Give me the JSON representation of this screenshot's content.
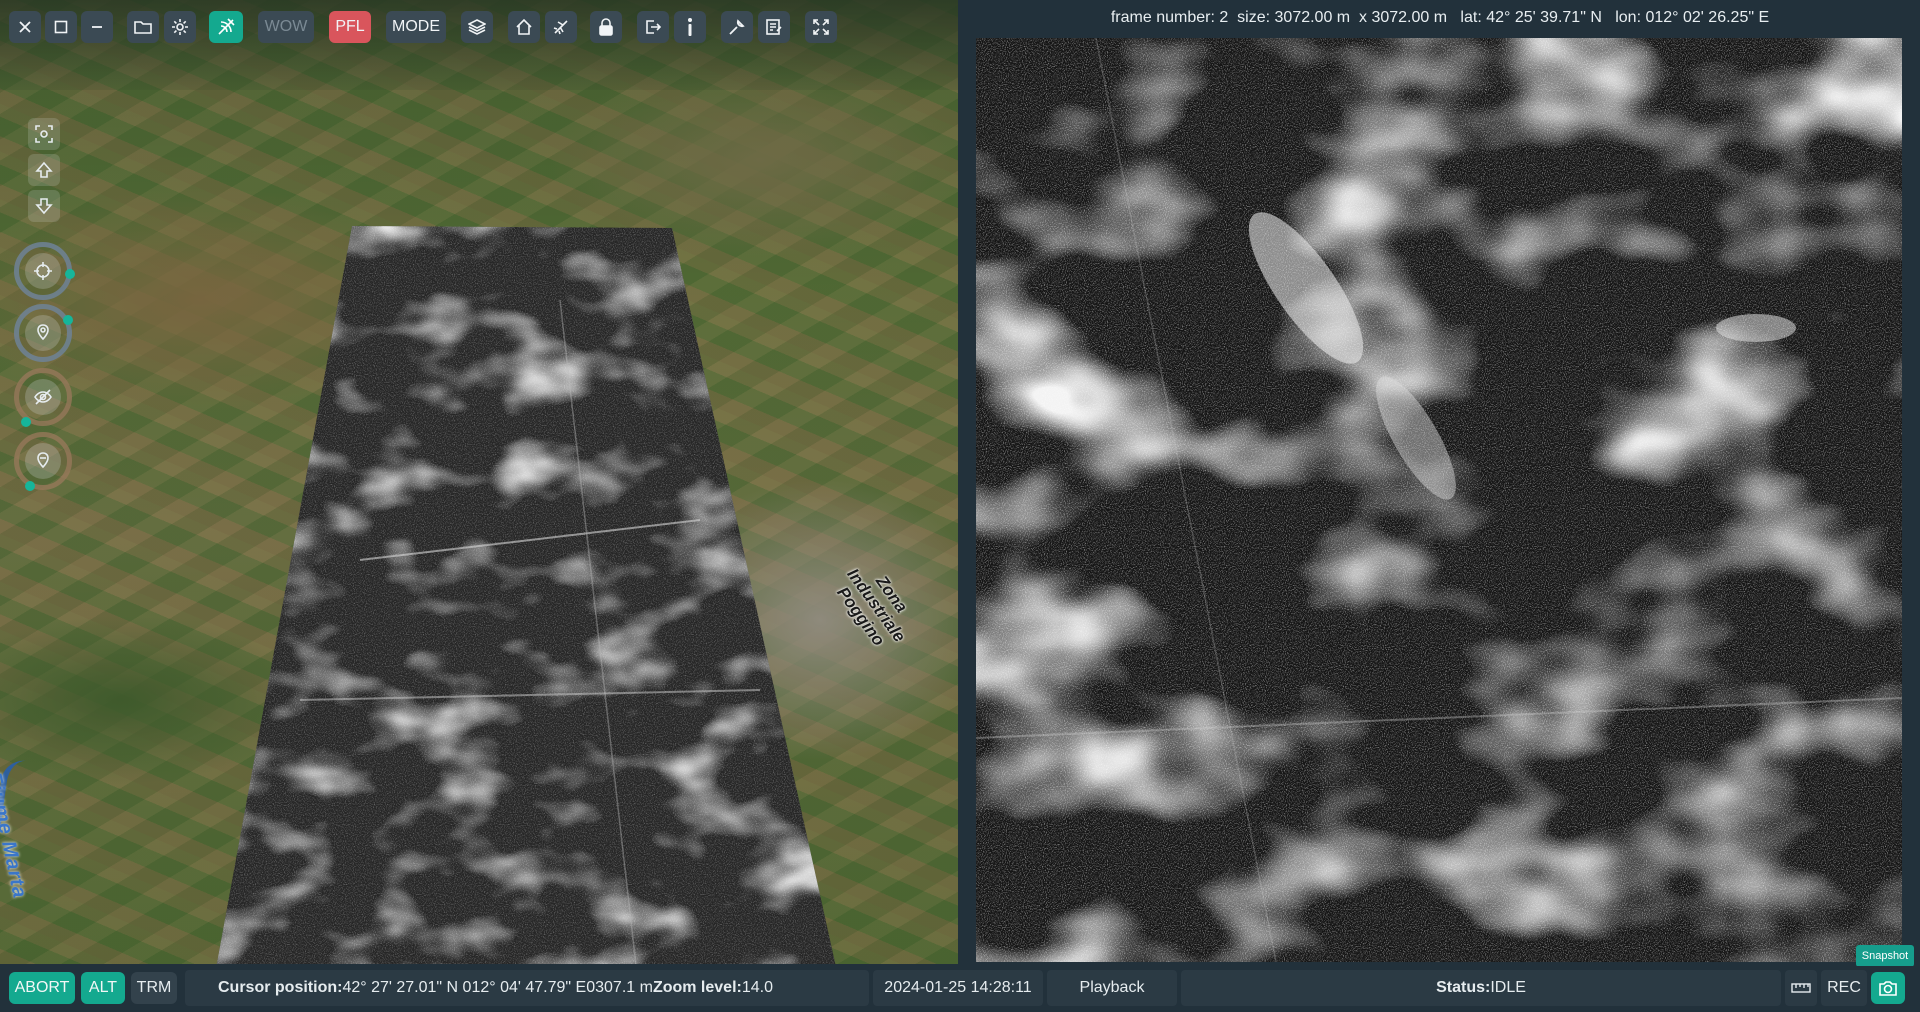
{
  "toolbar": {
    "wow_label": "WOW",
    "pfl_label": "PFL",
    "mode_label": "MODE",
    "icons": [
      "close-icon",
      "square-icon",
      "minus-icon",
      "folder-icon",
      "gear-icon",
      "satellite-icon",
      "layers-icon",
      "home-icon",
      "aircraft-icon",
      "lock-icon",
      "exit-icon",
      "info-icon",
      "wrench-icon",
      "notes-icon",
      "fullscreen-icon"
    ]
  },
  "map": {
    "river_label": "Fiume Marta",
    "town_label": "Zona Industriale Poggino"
  },
  "sar_panel": {
    "frame_label": "frame number:",
    "frame_number": "2",
    "size_label": "size:",
    "size_value": "3072.00 m  x 3072.00 m",
    "lat_label": "lat:",
    "lat_value": "42° 25' 39.71\" N",
    "lon_label": "lon:",
    "lon_value": "012° 02' 26.25\" E",
    "snapshot_label": "Snapshot"
  },
  "statusbar": {
    "abort_label": "ABORT",
    "alt_label": "ALT",
    "trm_label": "TRM",
    "cursor_label": "Cursor position:",
    "cursor_value": "42° 27' 27.01\" N 012° 04' 47.79\" E",
    "altitude_value": "0307.1 m",
    "zoom_label": "Zoom level:",
    "zoom_value": "14.0",
    "datetime": "2024-01-25 14:28:11",
    "playback_label": "Playback",
    "status_label": "Status:",
    "status_value": "IDLE",
    "rec_label": "REC"
  },
  "colors": {
    "accent_green": "#14a98f",
    "pfl_red": "#d9555c",
    "panel_bg": "#22313b"
  }
}
